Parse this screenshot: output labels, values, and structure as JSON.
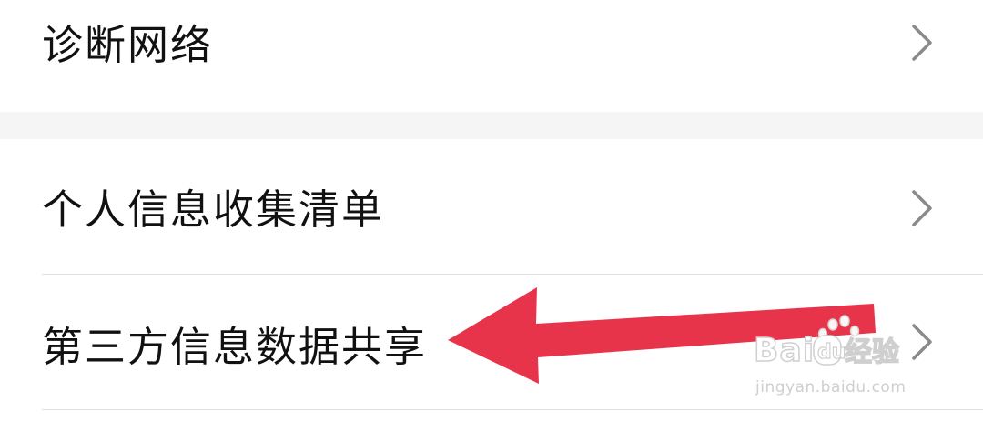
{
  "settings_list": {
    "items": [
      {
        "label": "诊断网络"
      },
      {
        "label": "个人信息收集清单"
      },
      {
        "label": "第三方信息数据共享"
      }
    ]
  },
  "annotation": {
    "arrow_color": "#e8344b"
  },
  "watermark": {
    "logo_text": "Baidu经验",
    "url": "jingyan.baidu.com"
  }
}
